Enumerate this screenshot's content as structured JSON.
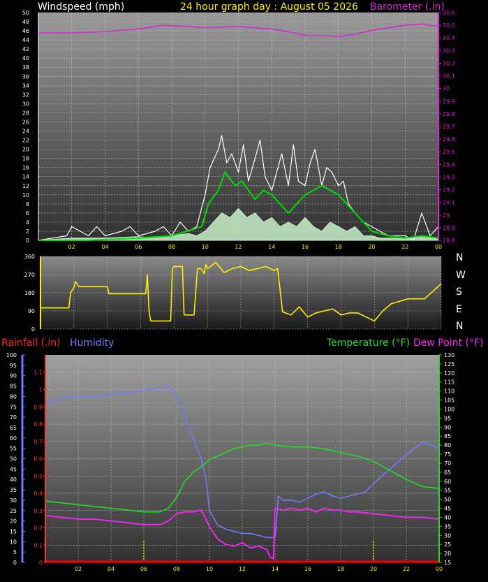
{
  "header": {
    "wind_label": "Windspeed (mph)",
    "title": "24 hour graph day : August 05 2026",
    "baro_label": "Barometer (.in)"
  },
  "labels": {
    "rain": "Rainfall (.in)",
    "humidity": "Humidity",
    "temperature": "Temperature (°F)",
    "dewpoint": "Dew Point (°F)"
  },
  "compass": [
    "N",
    "W",
    "S",
    "E",
    "N"
  ],
  "colors": {
    "wind_gust": "#ffffff",
    "wind_avg": "#00dd00",
    "wind_speed": "#c8f0c8",
    "barometer": "#dd22dd",
    "direction": "#ffee00",
    "humidity": "#7777ff",
    "temperature": "#22dd22",
    "dewpoint": "#ff22ff",
    "rain": "#ff0000",
    "rain_axis": "#ff3333",
    "time_tick": "#ffee00"
  },
  "chart_data": [
    {
      "type": "line",
      "name": "wind-barometer",
      "x_ticks": [
        "02",
        "04",
        "06",
        "08",
        "10",
        "12",
        "14",
        "16",
        "18",
        "20",
        "22",
        "00"
      ],
      "y_left": {
        "label": "Windspeed (mph)",
        "range": [
          0,
          50
        ],
        "ticks": [
          0,
          2,
          4,
          6,
          8,
          10,
          12,
          14,
          16,
          18,
          20,
          22,
          24,
          26,
          28,
          30,
          32,
          34,
          36,
          38,
          40,
          42,
          44,
          46,
          48,
          50
        ]
      },
      "y_right": {
        "label": "Barometer (.in)",
        "range": [
          28.8,
          30.6
        ],
        "ticks": [
          "28.8",
          "28.9",
          "29",
          "29.1",
          "29.2",
          "29.3",
          "29.4",
          "29.5",
          "29.6",
          "29.7",
          "29.8",
          "29.9",
          "30",
          "30.1",
          "30.2",
          "30.3",
          "30.4",
          "30.5",
          "30.6"
        ]
      },
      "series": [
        {
          "key": "barometer",
          "hours": [
            0,
            2,
            4,
            6,
            7.5,
            9,
            10,
            12,
            13,
            14,
            15,
            16,
            17,
            18,
            19,
            20,
            21,
            22,
            23,
            24
          ],
          "values": [
            30.44,
            30.44,
            30.45,
            30.47,
            30.5,
            30.49,
            30.48,
            30.49,
            30.48,
            30.47,
            30.45,
            30.42,
            30.42,
            30.41,
            30.43,
            30.46,
            30.48,
            30.5,
            30.51,
            30.49
          ]
        },
        {
          "key": "wind_avg",
          "hours": [
            0,
            3,
            6,
            8,
            9.8,
            10.2,
            10.8,
            11.2,
            11.8,
            12.2,
            13,
            13.5,
            14,
            15,
            16,
            17,
            18,
            19,
            20,
            21,
            22,
            23,
            24
          ],
          "values": [
            0,
            0,
            0.5,
            1,
            3,
            8,
            11,
            15,
            12,
            13,
            9,
            11,
            10,
            6,
            10,
            12,
            10,
            6,
            2,
            1,
            0.5,
            1,
            0.5
          ]
        },
        {
          "key": "wind_gust",
          "hours": [
            0,
            1.7,
            2,
            3,
            3.5,
            4,
            5,
            5.5,
            6,
            7,
            7.5,
            8,
            8.5,
            9,
            9.5,
            10,
            10.3,
            10.8,
            11,
            11.3,
            11.6,
            12,
            12.3,
            12.6,
            13,
            13.3,
            13.6,
            14,
            14.3,
            14.6,
            15,
            15.3,
            15.6,
            16,
            16.3,
            16.6,
            17,
            17.3,
            17.6,
            18,
            18.3,
            18.6,
            19,
            19.5,
            20,
            20.5,
            21,
            21.5,
            22,
            22.5,
            23,
            23.5,
            24
          ],
          "values": [
            0,
            1,
            3,
            1,
            3,
            1,
            2,
            3,
            1,
            2,
            3,
            1,
            4,
            2,
            3,
            10,
            16,
            20,
            23,
            17,
            19,
            15,
            21,
            13,
            18,
            22,
            14,
            11,
            15,
            19,
            12,
            21,
            13,
            12,
            17,
            20,
            12,
            16,
            15,
            12,
            13,
            8,
            6,
            4,
            3,
            2,
            1,
            1,
            1,
            0,
            6,
            1,
            3
          ]
        },
        {
          "key": "wind_speed",
          "hours": [
            0,
            2,
            4,
            6,
            7,
            8,
            9,
            9.5,
            10,
            10.5,
            11,
            11.5,
            12,
            12.5,
            13,
            13.5,
            14,
            14.5,
            15,
            15.5,
            16,
            16.5,
            17,
            17.5,
            18,
            18.5,
            19,
            19.5,
            20,
            20.5,
            21,
            22,
            23,
            24
          ],
          "values": [
            0,
            0.5,
            0.5,
            0.8,
            0.5,
            1,
            1.5,
            1,
            2,
            4,
            6,
            5,
            7,
            5,
            6,
            4,
            5,
            3,
            4,
            3,
            5,
            3,
            2,
            4,
            3,
            2,
            3,
            1,
            1,
            0.5,
            0.5,
            0.3,
            1,
            0.5
          ]
        }
      ]
    },
    {
      "type": "line",
      "name": "wind-direction",
      "x_ticks": [],
      "y_left": {
        "range": [
          0,
          360
        ],
        "ticks": [
          0,
          90,
          180,
          270,
          360
        ]
      },
      "series": [
        {
          "key": "direction",
          "hours": [
            0,
            1.7,
            1.8,
            2,
            2.1,
            2.3,
            4.0,
            4.1,
            6.3,
            6.4,
            6.5,
            6.6,
            7.8,
            7.9,
            8.0,
            8.5,
            8.6,
            9.2,
            9.4,
            9.6,
            9.8,
            9.9,
            10,
            10.5,
            11,
            11.5,
            12,
            12.5,
            13,
            13.5,
            14,
            14.2,
            14.5,
            15,
            15.5,
            16,
            16.5,
            17,
            17.5,
            18,
            18.5,
            19,
            19.5,
            20,
            20.5,
            21,
            22,
            23,
            24
          ],
          "values": [
            105,
            105,
            180,
            205,
            235,
            210,
            210,
            175,
            175,
            270,
            90,
            40,
            40,
            300,
            310,
            310,
            70,
            70,
            300,
            300,
            275,
            320,
            300,
            330,
            280,
            300,
            310,
            290,
            300,
            310,
            290,
            300,
            85,
            70,
            110,
            60,
            80,
            90,
            100,
            70,
            80,
            80,
            60,
            40,
            90,
            125,
            150,
            150,
            225
          ]
        }
      ]
    },
    {
      "type": "line",
      "name": "rain-humidity-temperature",
      "x_ticks": [
        "02",
        "04",
        "06",
        "08",
        "10",
        "12",
        "14",
        "16",
        "18",
        "20",
        "22",
        "00"
      ],
      "y_humidity": {
        "label": "Humidity",
        "range": [
          0,
          100
        ],
        "ticks": [
          0,
          5,
          10,
          15,
          20,
          25,
          30,
          35,
          40,
          45,
          50,
          55,
          60,
          65,
          70,
          75,
          80,
          85,
          90,
          95,
          100
        ]
      },
      "y_rain": {
        "label": "Rainfall (.in)",
        "range": [
          0,
          1.2
        ],
        "ticks": [
          "0",
          "0.1",
          "0.2",
          "0.3",
          "0.4",
          "0.5",
          "0.6",
          "0.7",
          "0.8",
          "0.9",
          "1",
          "1.1"
        ]
      },
      "y_temp": {
        "label": "Temperature (°F)",
        "range": [
          15,
          130
        ],
        "ticks": [
          15,
          20,
          25,
          30,
          35,
          40,
          45,
          50,
          55,
          60,
          65,
          70,
          75,
          80,
          85,
          90,
          95,
          100,
          105,
          110,
          115,
          120,
          125,
          130
        ]
      },
      "series": [
        {
          "key": "humidity",
          "hours": [
            0,
            1,
            2,
            3,
            4,
            5,
            6,
            7,
            7.5,
            8,
            8.5,
            9,
            9.5,
            9.8,
            10,
            10.5,
            11,
            11.5,
            12,
            12.5,
            13,
            13.5,
            14,
            14.2,
            14.5,
            15,
            15.5,
            16,
            16.5,
            17,
            17.5,
            18,
            18.5,
            19,
            19.5,
            20,
            21,
            22,
            23,
            24
          ],
          "values": [
            77,
            79,
            80,
            80,
            81,
            82,
            83,
            84,
            85,
            80,
            70,
            60,
            50,
            40,
            25,
            18,
            16,
            15,
            14,
            14,
            13,
            12,
            12,
            32,
            30,
            30,
            29,
            31,
            33,
            34,
            32,
            31,
            32,
            33,
            34,
            38,
            45,
            52,
            58,
            55
          ]
        },
        {
          "key": "temperature",
          "hours": [
            0,
            1,
            2,
            3,
            4,
            5,
            6,
            7,
            7.5,
            8,
            8.5,
            9,
            9.5,
            10,
            10.5,
            11,
            11.5,
            12,
            12.5,
            13,
            13.5,
            14,
            15,
            16,
            17,
            18,
            19,
            20,
            21,
            22,
            23,
            24
          ],
          "values": [
            49,
            48,
            47,
            46,
            45,
            44,
            43,
            43,
            45,
            51,
            60,
            65,
            68,
            72,
            74,
            76,
            78,
            79,
            80,
            80,
            81,
            80,
            79,
            79,
            78,
            76,
            74,
            71,
            66,
            61,
            57,
            56
          ]
        },
        {
          "key": "dewpoint",
          "hours": [
            0,
            1,
            2,
            3,
            4,
            5,
            6,
            7,
            7.5,
            8,
            8.5,
            9,
            9.5,
            10,
            10.5,
            11,
            11.5,
            12,
            12.5,
            13,
            13.5,
            13.7,
            13.9,
            14,
            14.5,
            15,
            15.5,
            16,
            16.5,
            17,
            17.5,
            18,
            18.5,
            19,
            20,
            21,
            22,
            23,
            24
          ],
          "values": [
            41,
            40,
            39,
            39,
            38,
            37,
            36,
            36,
            38,
            42,
            43,
            43,
            44,
            35,
            28,
            25,
            24,
            26,
            23,
            24,
            22,
            18,
            17,
            45,
            44,
            45,
            44,
            45,
            43,
            45,
            44,
            44,
            43,
            43,
            42,
            41,
            40,
            40,
            39
          ]
        },
        {
          "key": "rain",
          "hours": [
            0,
            24
          ],
          "values": [
            0,
            0
          ]
        }
      ]
    }
  ]
}
